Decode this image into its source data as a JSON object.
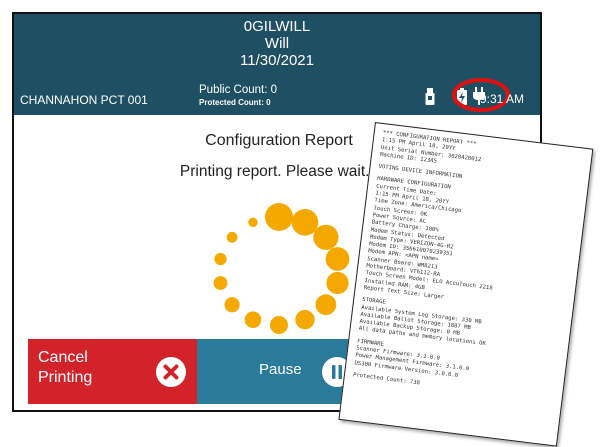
{
  "header": {
    "user_line1": "0GILWILL",
    "user_line2": "Will",
    "date": "11/30/2021",
    "precinct": "CHANNAHON PCT 001",
    "public_count": "Public Count: 0",
    "protected_count": "Protected Count: 0",
    "time": "9:31 AM"
  },
  "status_icons": [
    "usb-icon",
    "battery-charging-icon",
    "power-plug-icon"
  ],
  "main": {
    "title": "Configuration Report",
    "message": "Printing report. Please wait..."
  },
  "buttons": {
    "cancel": "Cancel Printing",
    "pause": "Pause"
  },
  "colors": {
    "header_bg": "#1f4f63",
    "spinner": "#f5a800",
    "cancel_bg": "#d3232a",
    "pause_bg": "#2a7a9b",
    "highlight_ring": "#e01010"
  },
  "receipt": {
    "lines": [
      "*** CONFIGURATION REPORT ***",
      "1:15 PM April 18, 20YY",
      "Unit Serial Number: 3020420012",
      "Machine ID: 12345",
      "",
      "VOTING DEVICE INFORMATION",
      "",
      "HARDWARE CONFIGURATION",
      "Current Time Date:",
      "  1:15 PM April 18, 20YY",
      "Time Zone: America/Chicago",
      "Touch Screen: OK",
      "Power Source: AC",
      "Battery Charge: 100%",
      "Modem Status: Detected",
      "Modem Type: VERIZON-4G-R2",
      "Modem ID: 356610070239351",
      "Modem APN: <APN name>",
      "Scanner Board: WM8213",
      "Motherboard: VT6112-RA",
      "Touch Screen Model: ELO AccuTouch 2218",
      "Installed RAM: 4GB",
      "Report Text Size: Larger",
      "",
      "STORAGE",
      "Available System Log Storage: 330 MB",
      "Available Ballot Storage: 1887 MB",
      "Available Backup Storage: 0 MB",
      "All data paths and memory locations OK",
      "",
      "FIRMWARE",
      "Scanner Firmware: 3.1.0.0",
      "Power Management Firmware: 3.1.0.0",
      "DS300 Firmware Version: 3.0.0.0",
      "",
      "Protected Count: 738"
    ]
  }
}
